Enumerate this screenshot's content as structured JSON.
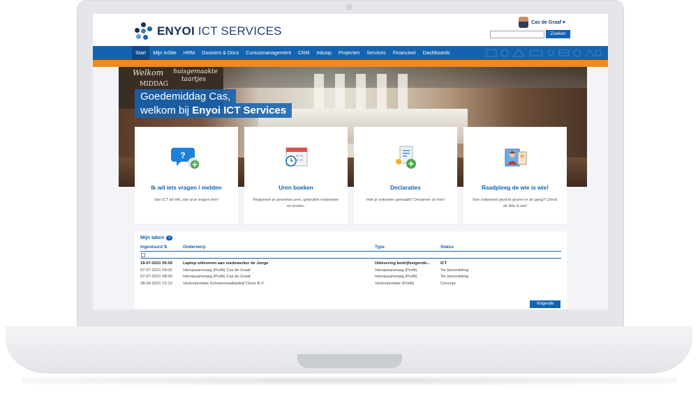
{
  "header": {
    "brand_bold": "ENYOI",
    "brand_rest": " ICT SERVICES",
    "user_name": "Cas de Graaf ▾",
    "search_placeholder": "",
    "search_button": "Zoeken"
  },
  "nav": {
    "items": [
      "Start",
      "Mijn InSite",
      "HRM",
      "Dossiers & Docs",
      "Cursusmanagement",
      "CRM",
      "Inkoop",
      "Projecten",
      "Services",
      "Financieel",
      "Dashboards"
    ],
    "active": "Start"
  },
  "hero": {
    "greeting_line1": "Goedemiddag Cas,",
    "greeting_line2_prefix": "welkom bij ",
    "greeting_line2_bold": "Enyoi ICT Services",
    "shelf_text_1": "Welkom",
    "shelf_text_2": "huisgemaakte",
    "shelf_text_3": "taartjes",
    "shelf_text_4": "MIDDAG"
  },
  "tiles": [
    {
      "title": "Ik wil iets vragen / melden",
      "desc": "Van ICT tot HR, stel al je vragen hier!",
      "icon": "question-bubble-icon"
    },
    {
      "title": "Uren boeken",
      "desc": "Registreer je gewerkte uren, gebruikte materialen en kosten.",
      "icon": "calendar-clock-icon"
    },
    {
      "title": "Declaraties",
      "desc": "Heb je onkosten gemaakt? Declareer ze hier!",
      "icon": "expense-document-icon"
    },
    {
      "title": "Raadpleeg de wie is wie!",
      "desc": "Een onbekend gezicht gezien in de gang? Check de Wie is wie!",
      "icon": "people-directory-icon"
    }
  ],
  "tasks": {
    "title": "Mijn taken",
    "badge": "»",
    "columns": {
      "date": "Ingestuurd ⇅",
      "subject": "Onderwerp",
      "type": "Type",
      "status": "Status"
    },
    "rows": [
      {
        "date": "18-07-2021 00:05",
        "subject": "Laptop uitleveren aan medewerker de Jonge",
        "type": "Uitlevering bedrijfseigendo...",
        "status": "ICT",
        "bold": true
      },
      {
        "date": "07-07-2021 09:02",
        "subject": "Inkoopaanvraag (Profit) Cas de Graaf",
        "type": "Inkoopaanvraag (Profit)",
        "status": "Ter beoordeling",
        "bold": false
      },
      {
        "date": "07-07-2021 08:59",
        "subject": "Inkoopaanvraag (Profit) Cas de Graaf",
        "type": "Inkoopaanvraag (Profit)",
        "status": "Ter beoordeling",
        "bold": false
      },
      {
        "date": "28-06-2021 12:13",
        "subject": "Verkooprelatie Schoonmaakbedrijf Clean B.V.",
        "type": "Verkooprelatie (Profit)",
        "status": "Concept",
        "bold": false
      }
    ],
    "next_button": "Volgende"
  },
  "colors": {
    "primary": "#1463b0",
    "accent": "#f08a1c",
    "brand_dark": "#1a2f55"
  }
}
